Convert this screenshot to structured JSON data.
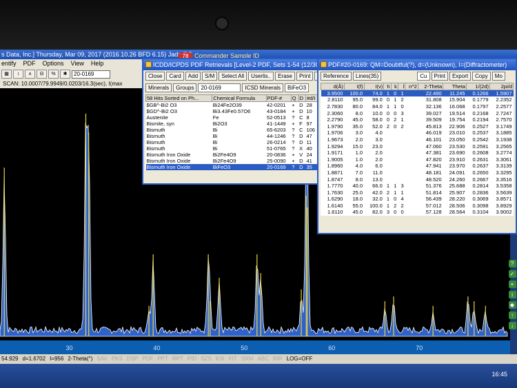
{
  "app": {
    "title": "s Data, Inc.] Thursday, Mar 09, 2017 (2016.10.26 BFD 6.15) Jade 7.5",
    "commander_title": "Commander Sample ID",
    "badge": "78",
    "menu": [
      "entify",
      "PDF",
      "Options",
      "View",
      "Help"
    ],
    "pdf_field": "20-0169",
    "scan_info": "SCAN: 10.0007/79.9949/0.0203/16.3(sec), I(max",
    "status": {
      "x": "54.929",
      "d": "d=1.6702",
      "i": "I=956",
      "mode": "2-Theta(°)",
      "tabs": [
        "SAV",
        "PKS",
        "DSP",
        "PDF",
        "PPT",
        "RPT",
        "PID",
        "SZS",
        "KSI",
        "FIT",
        "SRM",
        "ABC",
        "RIR"
      ],
      "log": "LOG=OFF"
    },
    "clock": "16:45",
    "right_icons": [
      "?",
      "✓",
      "+",
      "↕",
      "◆",
      "↑",
      "↓"
    ]
  },
  "icdd_window": {
    "title": "ICDD/ICPDS PDF Retrievals [Level-2 PDF, Sets 1-54 (12/30/99)]",
    "buttons": [
      "Close",
      "Card",
      "Add",
      "S/M",
      "Select All",
      "Userlis..",
      "Erase",
      "Print",
      "Sa"
    ],
    "buttons2": [
      "Minerals",
      "Groups"
    ],
    "pdf_select": "20-0169",
    "icsd_label": "ICSD Minerals",
    "formula_field": "BiFeO3",
    "columns": [
      "58 Hits Sorted on Ph...",
      "Chemical Formula",
      "PDF-#",
      "Q",
      "D",
      "#d/I"
    ],
    "rows": [
      [
        "$GB^-Bi2 O3",
        "Bi24Fe2O39",
        "42-0201",
        "+",
        "D",
        "28"
      ],
      [
        "$GD^-Bi2 O3",
        "Bi3.43Fe0.57O6",
        "43-0184",
        "+",
        "D",
        "10"
      ],
      [
        "Austenite",
        "Fe",
        "52-0513",
        "?",
        "C",
        "8"
      ],
      [
        "Bismite, syn",
        "Bi2O3",
        "41-1449",
        "+",
        "F",
        "97"
      ],
      [
        "Bismuth",
        "Bi",
        "65-6203",
        "?",
        "C",
        "106"
      ],
      [
        "Bismuth",
        "Bi",
        "44-1246",
        "?",
        "D",
        "47"
      ],
      [
        "Bismuth",
        "Bi",
        "26-0214",
        "?",
        "D",
        "11"
      ],
      [
        "Bismuth",
        "Bi",
        "51-0765",
        "?",
        "X",
        "40"
      ],
      [
        "Bismuth Iron Oxide",
        "Bi2Fe4O9",
        "20-0836",
        "+",
        "V",
        "24"
      ],
      [
        "Bismuth Iron Oxide",
        "Bi2Fe4O9",
        "25-0090",
        "+",
        "D",
        "41"
      ],
      [
        "Bismuth Iron Oxide",
        "BiFeO3",
        "20-0169",
        "?",
        "D",
        "35"
      ]
    ]
  },
  "pdf_window": {
    "title": "PDF#20-0169: QM=Doubtful(?), d=(Unknown), I=(Diffractometer)",
    "tabs": [
      "Reference",
      "Lines(35)"
    ],
    "target": "Cu",
    "buttons": [
      "Print",
      "Export",
      "Copy",
      "Mo"
    ],
    "columns": [
      "d(Å)",
      "I(f)",
      "I(v)",
      "h",
      "k",
      "l",
      "n^2",
      "2-Theta",
      "Theta",
      "1/(2d)",
      "2pi/d"
    ],
    "rows": [
      [
        "3.9500",
        "100.0",
        "74.0",
        "1",
        "0",
        "1",
        "",
        "22.490",
        "11.245",
        "0.1266",
        "1.5907"
      ],
      [
        "2.8110",
        "95.0",
        "99.0",
        "0",
        "1",
        "2",
        "",
        "31.808",
        "15.904",
        "0.1779",
        "2.2352"
      ],
      [
        "2.7830",
        "80.0",
        "84.0",
        "1",
        "1",
        "0",
        "",
        "32.136",
        "16.068",
        "0.1797",
        "2.2577"
      ],
      [
        "2.3060",
        "8.0",
        "10.0",
        "0",
        "0",
        "3",
        "",
        "39.027",
        "19.514",
        "0.2168",
        "2.7247"
      ],
      [
        "2.2790",
        "45.0",
        "58.0",
        "0",
        "2",
        "1",
        "",
        "39.509",
        "19.754",
        "0.2194",
        "2.7570"
      ],
      [
        "1.9790",
        "35.0",
        "52.0",
        "2",
        "0",
        "2",
        "",
        "45.813",
        "22.906",
        "0.2527",
        "3.1749"
      ],
      [
        "1.9706",
        "3.0",
        "4.0",
        "",
        "",
        "",
        "",
        "46.019",
        "23.010",
        "0.2537",
        "3.1885"
      ],
      [
        "1.9673",
        "2.0",
        "3.0",
        "",
        "",
        "",
        "",
        "46.101",
        "23.050",
        "0.2542",
        "3.1938"
      ],
      [
        "1.9294",
        "15.0",
        "23.0",
        "",
        "",
        "",
        "",
        "47.060",
        "23.530",
        "0.2591",
        "3.2565"
      ],
      [
        "1.9171",
        "1.0",
        "2.0",
        "",
        "",
        "",
        "",
        "47.381",
        "23.690",
        "0.2608",
        "3.2774"
      ],
      [
        "1.9005",
        "1.0",
        "2.0",
        "",
        "",
        "",
        "",
        "47.820",
        "23.910",
        "0.2631",
        "3.3061"
      ],
      [
        "1.8960",
        "4.0",
        "6.0",
        "",
        "",
        "",
        "",
        "47.941",
        "23.970",
        "0.2637",
        "3.3139"
      ],
      [
        "1.8871",
        "7.0",
        "11.0",
        "",
        "",
        "",
        "",
        "48.181",
        "24.091",
        "0.2650",
        "3.3295"
      ],
      [
        "1.8747",
        "8.0",
        "13.0",
        "",
        "",
        "",
        "",
        "48.520",
        "24.260",
        "0.2667",
        "3.3516"
      ],
      [
        "1.7770",
        "40.0",
        "66.0",
        "1",
        "1",
        "3",
        "",
        "51.376",
        "25.688",
        "0.2814",
        "3.5358"
      ],
      [
        "1.7630",
        "25.0",
        "42.0",
        "2",
        "1",
        "1",
        "",
        "51.814",
        "25.907",
        "0.2836",
        "3.5639"
      ],
      [
        "1.6290",
        "18.0",
        "32.0",
        "1",
        "0",
        "4",
        "",
        "56.439",
        "28.220",
        "0.3069",
        "3.8571"
      ],
      [
        "1.6140",
        "55.0",
        "100.0",
        "1",
        "2",
        "2",
        "",
        "57.012",
        "28.506",
        "0.3098",
        "3.8929"
      ],
      [
        "1.6110",
        "45.0",
        "82.0",
        "3",
        "0",
        "0",
        "",
        "57.128",
        "28.564",
        "0.3104",
        "3.9002"
      ]
    ]
  },
  "chart_data": {
    "type": "line",
    "xlabel": "",
    "ylabel": "",
    "x_ticks": [
      "30",
      "40",
      "50",
      "60",
      "70"
    ],
    "xlim": [
      22,
      80
    ],
    "peaks_2theta": [
      22.49,
      31.81,
      32.14,
      39.03,
      39.51,
      45.81,
      46.02,
      47.06,
      51.38,
      51.81,
      56.44,
      57.01,
      57.13,
      66.0,
      67.0,
      71.5,
      75.5,
      76.2,
      77.5
    ],
    "peak_heights": [
      0.67,
      0.9,
      0.82,
      0.08,
      0.3,
      0.3,
      0.1,
      0.2,
      0.3,
      0.22,
      0.15,
      0.55,
      0.5,
      0.1,
      0.12,
      0.08,
      0.12,
      0.1,
      0.08
    ],
    "colors": {
      "trace": "#ffffff",
      "reference": "#e8d44a",
      "fill": "#2f62c9",
      "axis": "#0c5fb0"
    }
  }
}
